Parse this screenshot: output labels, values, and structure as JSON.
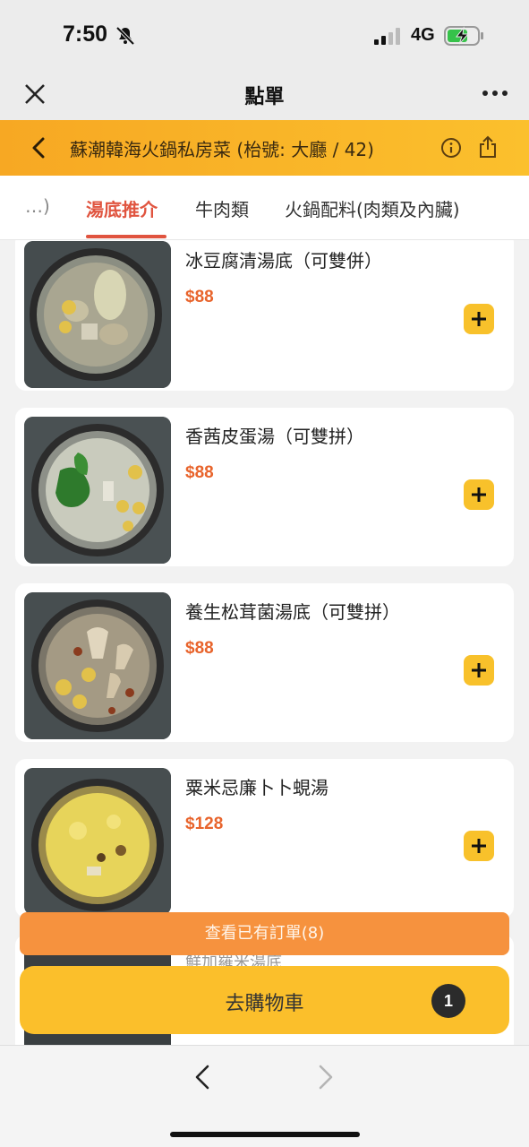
{
  "status": {
    "time": "7:50",
    "network": "4G"
  },
  "nav": {
    "title": "點單"
  },
  "restaurant": {
    "name": "蘇潮韓海火鍋私房菜 (枱號: 大廳 / 42)"
  },
  "tabs": [
    {
      "label": "…)"
    },
    {
      "label": "湯底推介",
      "active": true
    },
    {
      "label": "牛肉類"
    },
    {
      "label": "火鍋配料(肉類及內臟)"
    }
  ],
  "dishes": [
    {
      "name": "冰豆腐清湯底（可雙併）",
      "price": "$88"
    },
    {
      "name": "香茜皮蛋湯（可雙拼）",
      "price": "$88"
    },
    {
      "name": "養生松茸菌湯底（可雙拼）",
      "price": "$88"
    },
    {
      "name": "粟米忌廉卜卜蜆湯",
      "price": "$128"
    }
  ],
  "peek_dish": {
    "name": "鮮加羅米湯底"
  },
  "view_orders": {
    "label": "查看已有訂單(8)"
  },
  "cart": {
    "label": "去購物車",
    "count": "1"
  },
  "colors": {
    "accent": "#fbc02d",
    "price": "#e8642c",
    "active_tab": "#e0543f",
    "orders_button": "#f6923e"
  }
}
